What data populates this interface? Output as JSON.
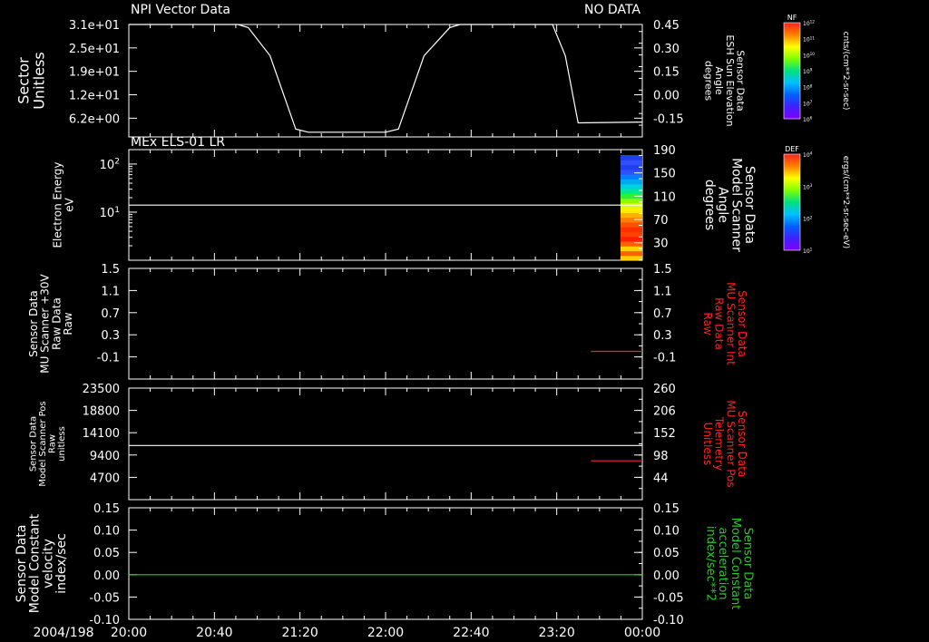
{
  "colors": {
    "white": "#ffffff",
    "red": "#ff2020",
    "green": "#22cc22",
    "background": "#000000"
  },
  "header": {
    "panel1_title": "NPI Vector Data",
    "panel1_status": "NO DATA",
    "panel2_title": "MEx ELS-01 LR"
  },
  "x_axis": {
    "date": "2004/198",
    "ticks": [
      "20:00",
      "20:40",
      "21:20",
      "22:00",
      "22:40",
      "23:20",
      "00:00"
    ],
    "tick_hours": [
      20.0,
      20.6667,
      21.3333,
      22.0,
      22.6667,
      23.3333,
      24.0
    ]
  },
  "colorbars": {
    "nf": {
      "title": "NF",
      "unit": "cnts/(cm**2-sr-sec)",
      "ticks": [
        "10^12",
        "10^11",
        "10^10",
        "10^9",
        "10^8",
        "10^7",
        "10^6"
      ]
    },
    "def": {
      "title": "DEF",
      "unit": "ergs/(cm**2-sr-sec-eV)",
      "ticks": [
        "10^4",
        "10^3",
        "10^2",
        "10^1"
      ]
    }
  },
  "chart_data": [
    {
      "type": "line",
      "left_axis": {
        "label": [
          "Sector",
          "Unitless"
        ],
        "ticks": [
          "3.1e+01",
          "2.5e+01",
          "1.9e+01",
          "1.2e+01",
          "6.2e+00"
        ]
      },
      "right_axis": {
        "label": [
          "Sensor Data",
          "ESH Sun Elevation",
          "Angle",
          "degrees"
        ],
        "ticks": [
          "0.45",
          "0.30",
          "0.15",
          "0.00",
          "-0.15"
        ],
        "tick_values": [
          0.45,
          0.3,
          0.15,
          0.0,
          -0.15
        ],
        "ylim": [
          -0.27,
          0.45
        ]
      },
      "series": [
        {
          "color": "white",
          "x": [
            20.0,
            20.85,
            20.93,
            21.1,
            21.3,
            21.4,
            22.0,
            22.1,
            22.3,
            22.5,
            22.58,
            23.3,
            23.4,
            23.5,
            24.0
          ],
          "y": [
            0.45,
            0.45,
            0.43,
            0.25,
            -0.22,
            -0.24,
            -0.24,
            -0.22,
            0.25,
            0.43,
            0.45,
            0.45,
            0.25,
            -0.18,
            -0.175
          ]
        }
      ]
    },
    {
      "type": "heatmap",
      "left_axis": {
        "label": [
          "Electron Energy",
          "eV"
        ],
        "ticks": [
          "10^2",
          "10^1"
        ],
        "ylim_log": [
          0,
          2.3
        ]
      },
      "right_axis": {
        "label": [
          "Sensor Data",
          "Model Scanner",
          "Angle",
          "degrees"
        ],
        "ticks": [
          "190",
          "150",
          "110",
          "70",
          "30"
        ],
        "tick_values": [
          190,
          150,
          110,
          70,
          30
        ],
        "ylim": [
          0,
          190
        ]
      },
      "series": [
        {
          "color": "white",
          "x": [
            20.0,
            24.0
          ],
          "y": [
            14,
            14
          ]
        }
      ],
      "spectrogram": {
        "x_start": 23.83,
        "x_end": 24.0,
        "rows_low_to_high": [
          "#ffd000",
          "#ff6000",
          "#ffd000",
          "#ff6000",
          "#ff2000",
          "#ff4000",
          "#ff3000",
          "#ff5000",
          "#ff8000",
          "#ffb000",
          "#ffee00",
          "#d8ff00",
          "#88ff00",
          "#30f030",
          "#00e890",
          "#00d0e0",
          "#00a8f0",
          "#0080ff",
          "#3050ff",
          "#2040ee",
          "#3050ff",
          "#2040ee"
        ]
      }
    },
    {
      "type": "line",
      "left_axis": {
        "label": [
          "Sensor Data",
          "MU Scanner +30V",
          "Raw Data",
          "Raw"
        ],
        "ticks": [
          "1.5",
          "1.1",
          "0.7",
          "0.3",
          "-0.1"
        ],
        "tick_values": [
          1.5,
          1.1,
          0.7,
          0.3,
          -0.1
        ],
        "ylim": [
          -0.5,
          1.5
        ]
      },
      "right_axis": {
        "label": [
          "Sensor Data",
          "MU Scanner Int",
          "Raw Data",
          "Raw"
        ],
        "ticks": [
          "1.5",
          "1.1",
          "0.7",
          "0.3",
          "-0.1"
        ],
        "tick_values": [
          1.5,
          1.1,
          0.7,
          0.3,
          -0.1
        ],
        "ylim": [
          -0.5,
          1.5
        ]
      },
      "series": [
        {
          "color": "red",
          "x": [
            23.6,
            24.0
          ],
          "y": [
            0.0,
            0.0
          ]
        }
      ]
    },
    {
      "type": "line",
      "left_axis": {
        "label": [
          "Sensor Data",
          "Model Scanner Pos",
          "Raw",
          "unitless"
        ],
        "ticks": [
          "23500",
          "18800",
          "14100",
          "9400",
          "4700"
        ],
        "tick_values": [
          23500,
          18800,
          14100,
          9400,
          4700
        ],
        "ylim": [
          0,
          23500
        ]
      },
      "right_axis": {
        "label": [
          "Sensor Data",
          "MU Scanner Pos",
          "Telemetry",
          "Unitless"
        ],
        "ticks": [
          "260",
          "206",
          "152",
          "98",
          "44"
        ],
        "tick_values": [
          260,
          206,
          152,
          98,
          44
        ],
        "ylim": [
          -10,
          260
        ]
      },
      "series": [
        {
          "color": "white",
          "axis": "left",
          "x": [
            20.0,
            24.0
          ],
          "y": [
            11400,
            11400
          ]
        },
        {
          "color": "red",
          "axis": "right",
          "x": [
            23.6,
            24.0
          ],
          "y": [
            84,
            84
          ]
        }
      ]
    },
    {
      "type": "line",
      "left_axis": {
        "label": [
          "Sensor Data",
          "Model Constant",
          "velocity",
          "index/sec"
        ],
        "ticks": [
          "0.15",
          "0.10",
          "0.05",
          "0.00",
          "-0.05",
          "-0.10"
        ],
        "tick_values": [
          0.15,
          0.1,
          0.05,
          0.0,
          -0.05,
          -0.1
        ],
        "ylim": [
          -0.1,
          0.15
        ]
      },
      "right_axis": {
        "label": [
          "Sensor Data",
          "Model Constant",
          "acceleration",
          "index/sec**2"
        ],
        "ticks": [
          "0.15",
          "0.10",
          "0.05",
          "0.00",
          "-0.05",
          "-0.10"
        ],
        "tick_values": [
          0.15,
          0.1,
          0.05,
          0.0,
          -0.05,
          -0.1
        ],
        "ylim": [
          -0.1,
          0.15
        ]
      },
      "series": [
        {
          "color": "green",
          "x": [
            20.0,
            24.0
          ],
          "y": [
            0.0,
            0.0
          ]
        }
      ]
    }
  ]
}
